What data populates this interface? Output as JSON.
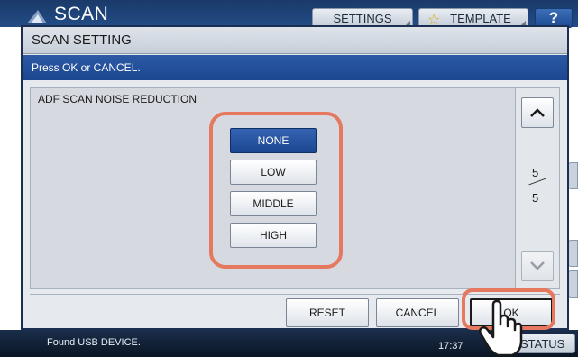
{
  "app": {
    "title": "SCAN"
  },
  "topbar": {
    "settings_label": "SETTINGS",
    "template_label": "TEMPLATE",
    "help_label": "?"
  },
  "dialog": {
    "title": "SCAN SETTING",
    "message": "Press OK or CANCEL.",
    "setting_label": "ADF SCAN NOISE REDUCTION",
    "options": [
      {
        "label": "NONE",
        "selected": true
      },
      {
        "label": "LOW",
        "selected": false
      },
      {
        "label": "MIDDLE",
        "selected": false
      },
      {
        "label": "HIGH",
        "selected": false
      }
    ],
    "page": {
      "current": "5",
      "total": "5"
    },
    "buttons": {
      "reset": "RESET",
      "cancel": "CANCEL",
      "ok": "OK"
    }
  },
  "statusbar": {
    "message": "Found USB DEVICE.",
    "time": "17:37",
    "job_status_label": "STATUS"
  },
  "colors": {
    "accent": "#1c4791",
    "highlight": "#e5785e"
  },
  "icons": [
    "scan-logo-icon",
    "star-icon",
    "chevron-up-icon",
    "chevron-down-icon",
    "hand-pointer-icon"
  ]
}
